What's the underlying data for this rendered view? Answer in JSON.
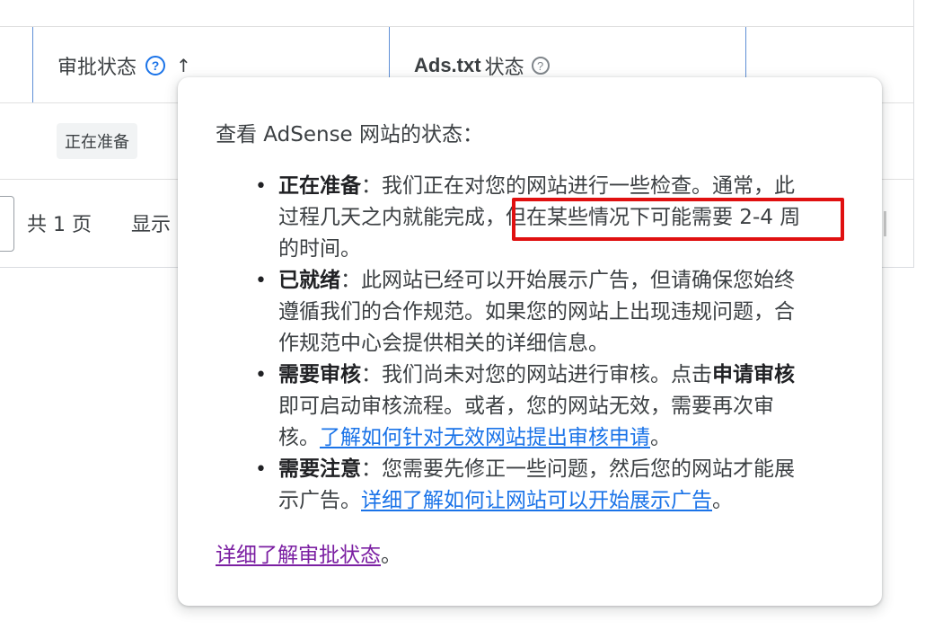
{
  "table": {
    "header": {
      "approval_status": "审批状态",
      "ads_txt_label": "Ads.txt",
      "ads_txt_suffix": "状态"
    },
    "row": {
      "status_chip": "正在准备"
    },
    "pagination": {
      "total_pages": "共 1 页",
      "show_label": "显示"
    }
  },
  "tooltip": {
    "intro": "查看 AdSense 网站的状态：",
    "items": [
      {
        "term": "正在准备",
        "line1": "：我们正在对您的网站进行一些检查。通常，此",
        "line2": "过程几天之内就能完成，",
        "line2_highlight": "但在某些情况下可能需要 2-4 周",
        "line3": "的时间。"
      },
      {
        "term": "已就绪",
        "line1": "：此网站已经可以开始展示广告，但请确保您始终",
        "line2": "遵循我们的合作规范。如果您的网站上出现违规问题，合",
        "line3": "作规范中心会提供相关的详细信息。"
      },
      {
        "term": "需要审核",
        "line1": "：我们尚未对您的网站进行审核。点击",
        "line1_bold": "申请审核",
        "line2": "即可启动审核流程。或者，您的网站无效，需要再次审",
        "line3_prefix": "核。",
        "line3_link": "了解如何针对无效网站提出审核申请",
        "line3_suffix": "。"
      },
      {
        "term": "需要注意",
        "line1": "：您需要先修正一些问题，然后您的网站才能展",
        "line2_prefix": "示广告。",
        "line2_link": "详细了解如何让网站可以开始展示广告",
        "line2_suffix": "。"
      }
    ],
    "footer_link": "详细了解审批状态",
    "footer_suffix": "。"
  },
  "icons": {
    "help": "help-circle-icon",
    "sort": "arrow-up-icon"
  },
  "colors": {
    "link_blue": "#1a73e8",
    "visited_purple": "#7b1fa2",
    "highlight_red": "#e01010"
  }
}
